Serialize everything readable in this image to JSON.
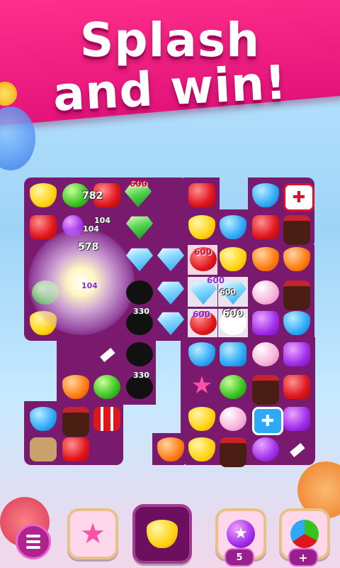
{
  "headline": {
    "line1": "Splash",
    "line2": "and win!"
  },
  "board": {
    "scores": {
      "s782": "782",
      "s104a": "104",
      "s104b": "104",
      "s578": "578",
      "s104c": "104",
      "s600a": "600",
      "s600b": "600",
      "s600c": "600",
      "s600d": "600",
      "s600e": "600",
      "s330a": "330",
      "s330b": "330"
    }
  },
  "toolbar": {
    "bomb_count": "5",
    "add_label": "+"
  },
  "colors": {
    "banner": "#e4137a",
    "board": "#7a1a6e",
    "toolbar_button": "#b0228f"
  },
  "icons": [
    "menu-icon",
    "rainbow-star-icon",
    "yellow-gem-icon",
    "bomb-icon",
    "color-splash-icon"
  ]
}
